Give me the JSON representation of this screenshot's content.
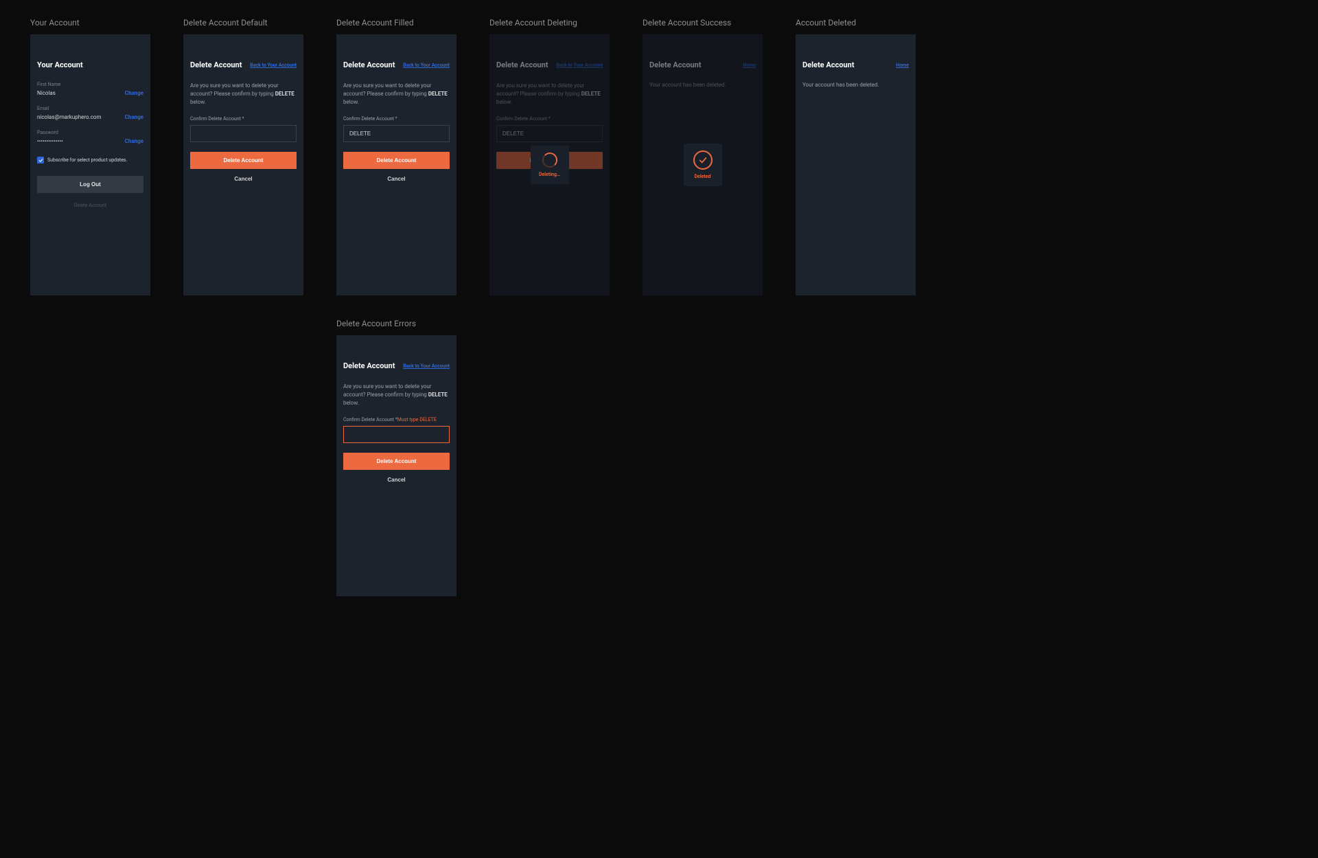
{
  "frames": {
    "your_account": "Your Account",
    "delete_default": "Delete Account Default",
    "delete_filled": "Delete Account Filled",
    "delete_deleting": "Delete Account Deleting",
    "delete_success": "Delete Account Success",
    "account_deleted": "Account Deleted",
    "delete_errors": "Delete Account Errors"
  },
  "account": {
    "title": "Your Account",
    "first_name_label": "First Name",
    "first_name_value": "Nicolas",
    "email_label": "Email",
    "email_value": "nicolas@markuphero.com",
    "password_label": "Password",
    "password_value": "••••••••••••••",
    "change": "Change",
    "subscribe_label": "Subscribe for select product updates.",
    "logout": "Log Out",
    "delete_link": "Delete Account"
  },
  "delete": {
    "title": "Delete Account",
    "back_link": "Back to Your Account",
    "home_link": "Home",
    "prompt_pre": "Are you sure you want to delete your account? Please confirm by typing ",
    "prompt_keyword": "DELETE",
    "prompt_post": " below.",
    "confirm_label": "Confirm Delete Account *",
    "confirm_label_base": "Confirm Delete Account *",
    "error_suffix": "Must type DELETE",
    "filled_value": "DELETE",
    "delete_btn": "Delete Account",
    "cancel_btn": "Cancel",
    "deleting_modal": "Deleting…",
    "deleted_modal": "Deleted",
    "success_text": "Your account has been deleted.",
    "deleted_text": "Your account has been deleted."
  },
  "colors": {
    "accent": "#ed6a40",
    "link": "#2f68d6",
    "panel": "#1d232c",
    "bg": "#0b0b0b"
  }
}
